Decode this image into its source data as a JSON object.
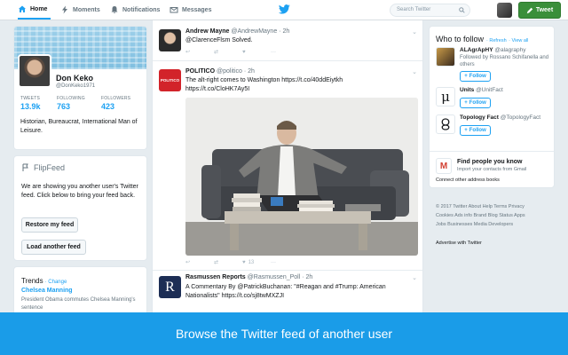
{
  "nav": {
    "home": "Home",
    "moments": "Moments",
    "notifications": "Notifications",
    "messages": "Messages",
    "search_placeholder": "Search Twitter",
    "tweet_button": "Tweet"
  },
  "profile": {
    "name": "Don Keko",
    "handle": "@DonKeko1971",
    "stats": [
      {
        "label": "TWEETS",
        "value": "13.9k"
      },
      {
        "label": "FOLLOWING",
        "value": "763"
      },
      {
        "label": "FOLLOWERS",
        "value": "423"
      }
    ],
    "bio": "Historian, Bureaucrat, International Man of Leisure."
  },
  "flipfeed": {
    "title": "FlipFeed",
    "text": "We are showing you another user's Twitter feed. Click below to bring your feed back.",
    "restore_button": "Restore my feed",
    "load_button": "Load another feed"
  },
  "trends": {
    "title": "Trends",
    "change": "· Change",
    "items": [
      {
        "name": "Chelsea Manning",
        "desc": "President Obama commutes Chelsea Manning's sentence"
      }
    ]
  },
  "tweets": [
    {
      "name": "Andrew Mayne",
      "handle": "@AndrewMayne",
      "time": "· 2h",
      "text": "@ClarenceFlsm Solved.",
      "likes": ""
    },
    {
      "name": "POLITICO",
      "handle": "@politico",
      "time": "· 2h",
      "text_line1": "The alt-right comes to Washington https://t.co/40ddEiytkh",
      "text_line2": "https://t.co/CloHK7Ay5I",
      "avatar_text": "POLITICO",
      "likes": "13"
    },
    {
      "name": "Rasmussen Reports",
      "handle": "@Rasmussen_Poll",
      "time": "· 2h",
      "text": "A Commentary By @PatrickBuchanan: \"#Reagan and #Trump: American Nationalists\" https://t.co/sj8twMXZJI",
      "avatar_text": "R"
    }
  ],
  "who_to_follow": {
    "title": "Who to follow",
    "refresh": "· Refresh",
    "view_all": "· View all",
    "follow_label": "Follow",
    "suggestions": [
      {
        "name": "ALAgrApHY",
        "handle": "@alagraphy",
        "desc": "Followed by Rossano Schifanella and others"
      },
      {
        "name": "Units",
        "handle": "@UnitFact",
        "desc": ""
      },
      {
        "name": "Topology Fact",
        "handle": "@TopologyFact",
        "desc": ""
      }
    ],
    "find_people_title": "Find people you know",
    "find_people_sub": "Import your contacts from Gmail",
    "connect": "Connect other address books"
  },
  "footer": {
    "line1": "© 2017 Twitter  About  Help  Terms  Privacy",
    "line2": "Cookies  Ads info  Brand  Blog  Status  Apps",
    "line3": "Jobs  Businesses  Media  Developers",
    "advertise": "Advertise with Twitter"
  },
  "caption": "Browse the Twitter feed of another user",
  "colors": {
    "accent": "#1da1f2",
    "tweet_button": "#3a8f3a",
    "caption_bg": "#1a9ce8"
  }
}
